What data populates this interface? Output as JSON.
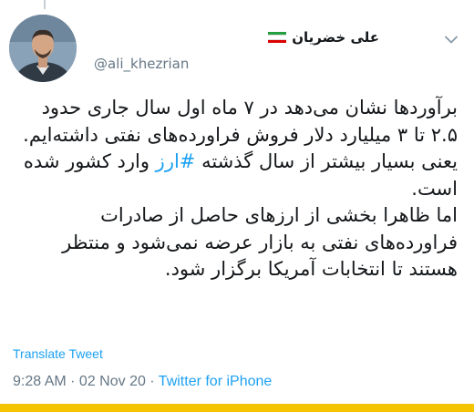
{
  "author": {
    "display_name": "علی خضریان",
    "handle": "@ali_khezrian",
    "flag_colors": [
      "#239f40",
      "#ffffff",
      "#da0000"
    ]
  },
  "tweet": {
    "paragraph1_before": "برآوردها نشان می‌دهد در ۷ ماه اول سال جاری حدود ۲.۵ تا ۳ میلیارد دلار فروش فراورده‌های نفتی داشته‌ایم. یعنی بسیار بیشتر از سال گذشته ",
    "hashtag": "#ارز",
    "paragraph1_after": " وارد کشور شده است.",
    "paragraph2": "اما ظاهرا بخشی از ارزهای حاصل از صادرات فراورده‌های نفتی به بازار عرضه نمی‌شود و منتظر هستند تا انتخابات آمریکا برگزار شود."
  },
  "translate_label": "Translate Tweet",
  "meta": {
    "time": "9:28 AM",
    "separator": " · ",
    "date": "02 Nov 20",
    "source": "Twitter for iPhone"
  },
  "colors": {
    "link": "#1da1f2",
    "secondary_text": "#657786",
    "bottom_bar": "#f5c400"
  },
  "icons": {
    "menu": "chevron-down-icon"
  }
}
